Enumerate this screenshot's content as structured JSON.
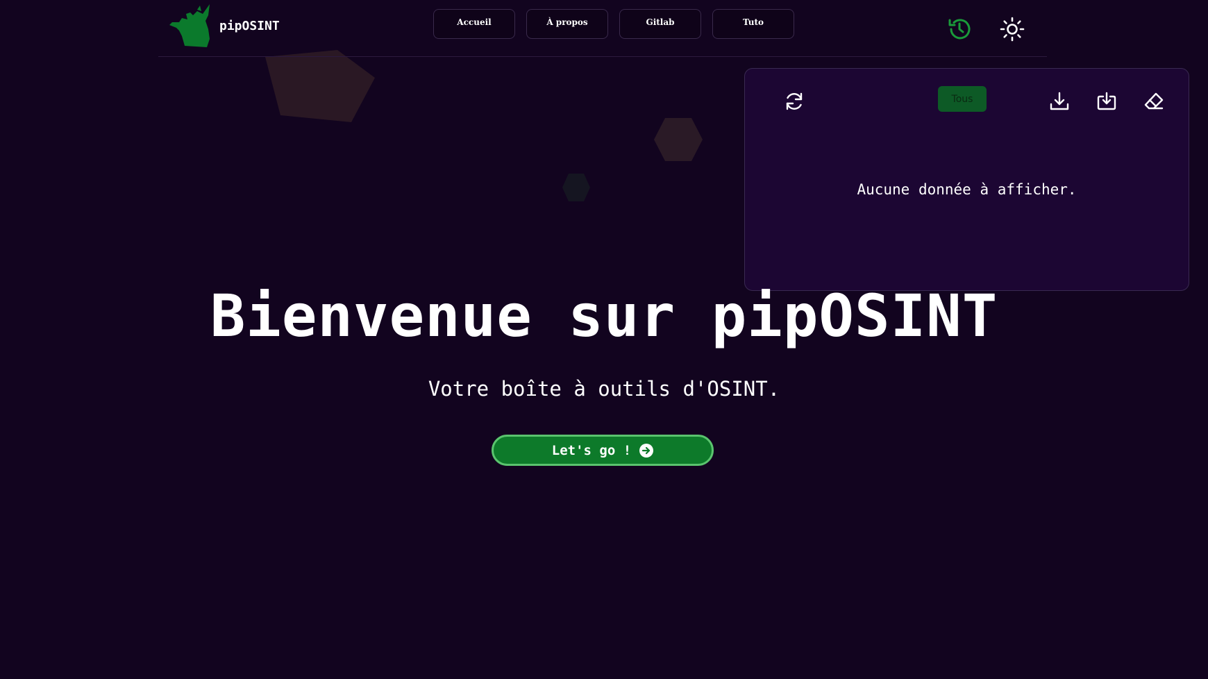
{
  "brand": {
    "name": "pipOSINT",
    "logo_icon": "pip-mascot-logo-icon"
  },
  "nav": [
    {
      "label": "Accueil"
    },
    {
      "label": "À propos"
    },
    {
      "label": "Gitlab"
    },
    {
      "label": "Tuto"
    }
  ],
  "header_icons": {
    "history": "history-icon",
    "theme": "sun-icon"
  },
  "history_panel": {
    "filter_label": "Tous",
    "empty_message": "Aucune donnée à afficher.",
    "icons": [
      "refresh-icon",
      "download-icon",
      "import-icon",
      "eraser-icon"
    ]
  },
  "hero": {
    "title": "Bienvenue sur pipOSINT",
    "subtitle": "Votre boîte à outils d'OSINT.",
    "cta_label": "Let's go !",
    "cta_icon": "arrow-right-circle-icon"
  },
  "colors": {
    "background": "#12041f",
    "panel": "#1c0633",
    "accent_green": "#0d7a2a",
    "history_icon": "#1a9a3a"
  }
}
